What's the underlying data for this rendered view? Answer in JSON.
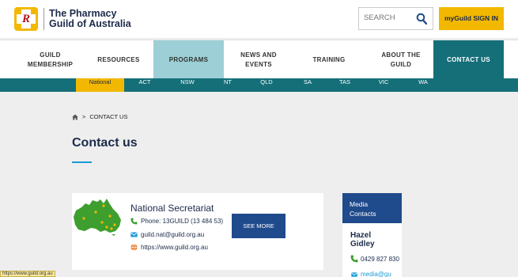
{
  "brand": {
    "line1": "The Pharmacy",
    "line2": "Guild of Australia"
  },
  "search": {
    "placeholder": "SEARCH"
  },
  "signin_label": "myGuild SIGN IN",
  "nav": {
    "membership": "GUILD MEMBERSHIP",
    "resources": "RESOURCES",
    "programs": "PROGRAMS",
    "news": "NEWS AND EVENTS",
    "training": "TRAINING",
    "about": "ABOUT THE GUILD",
    "contact": "CONTACT US"
  },
  "states": [
    "National",
    "ACT",
    "NSW",
    "NT",
    "QLD",
    "SA",
    "TAS",
    "VIC",
    "WA"
  ],
  "breadcrumb": {
    "separator": ">",
    "current": "CONTACT US"
  },
  "page_title": "Contact us",
  "card": {
    "title": "National Secretariat",
    "phone": "Phone: 13GUILD (13 484 53)",
    "email": "guild.nat@guild.org.au",
    "website": "https://www.guild.org.au",
    "button": "SEE MORE"
  },
  "media": {
    "heading_line1": "Media",
    "heading_line2": "Contacts",
    "name_line1": "Hazel",
    "name_line2": "Gidley",
    "phone": "0429 827 830",
    "email": "media@gu"
  },
  "status_url": "https://www.guild.org.au",
  "colors": {
    "teal": "#156f79",
    "gold": "#f2b800",
    "navy": "#1f4a8b",
    "light_teal": "#9ccfd6"
  }
}
